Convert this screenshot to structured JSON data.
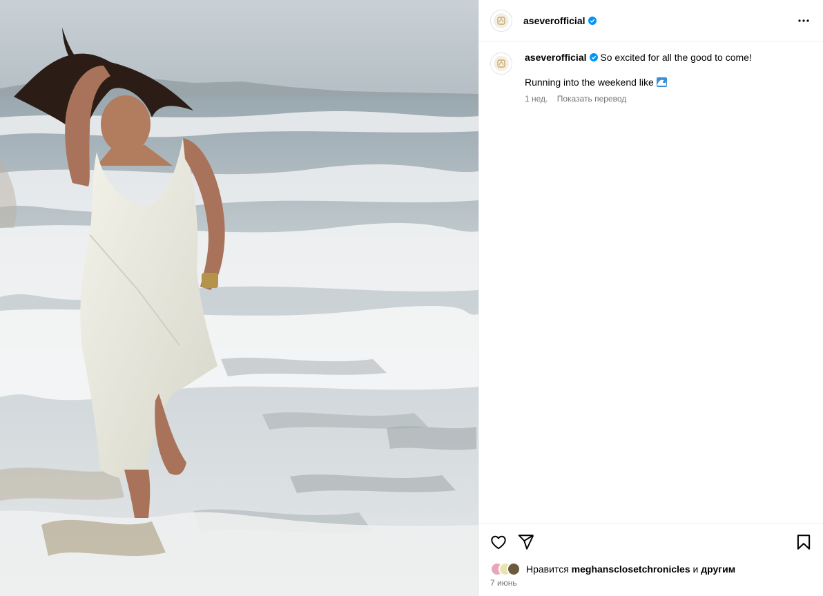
{
  "post": {
    "username": "aseverofficial",
    "more_icon": "more-horizontal-icon",
    "verified_icon": "verified-badge-icon"
  },
  "caption": {
    "username": "aseverofficial",
    "line1": "So excited for all the good to come!",
    "line2": "Running into the weekend like",
    "emoji_icon": "wave-emoji-icon",
    "time_ago": "1 нед.",
    "translate": "Показать перевод"
  },
  "actions": {
    "like_icon": "heart-icon",
    "share_icon": "paper-plane-icon",
    "save_icon": "bookmark-icon"
  },
  "likes": {
    "prefix": "Нравится",
    "user": "meghansclosetchronicles",
    "conjunction": "и",
    "others": "другим"
  },
  "date": "7 июнь",
  "colors": {
    "verified": "#0095f6",
    "secondary_text": "#737373",
    "divider": "#efefef"
  }
}
